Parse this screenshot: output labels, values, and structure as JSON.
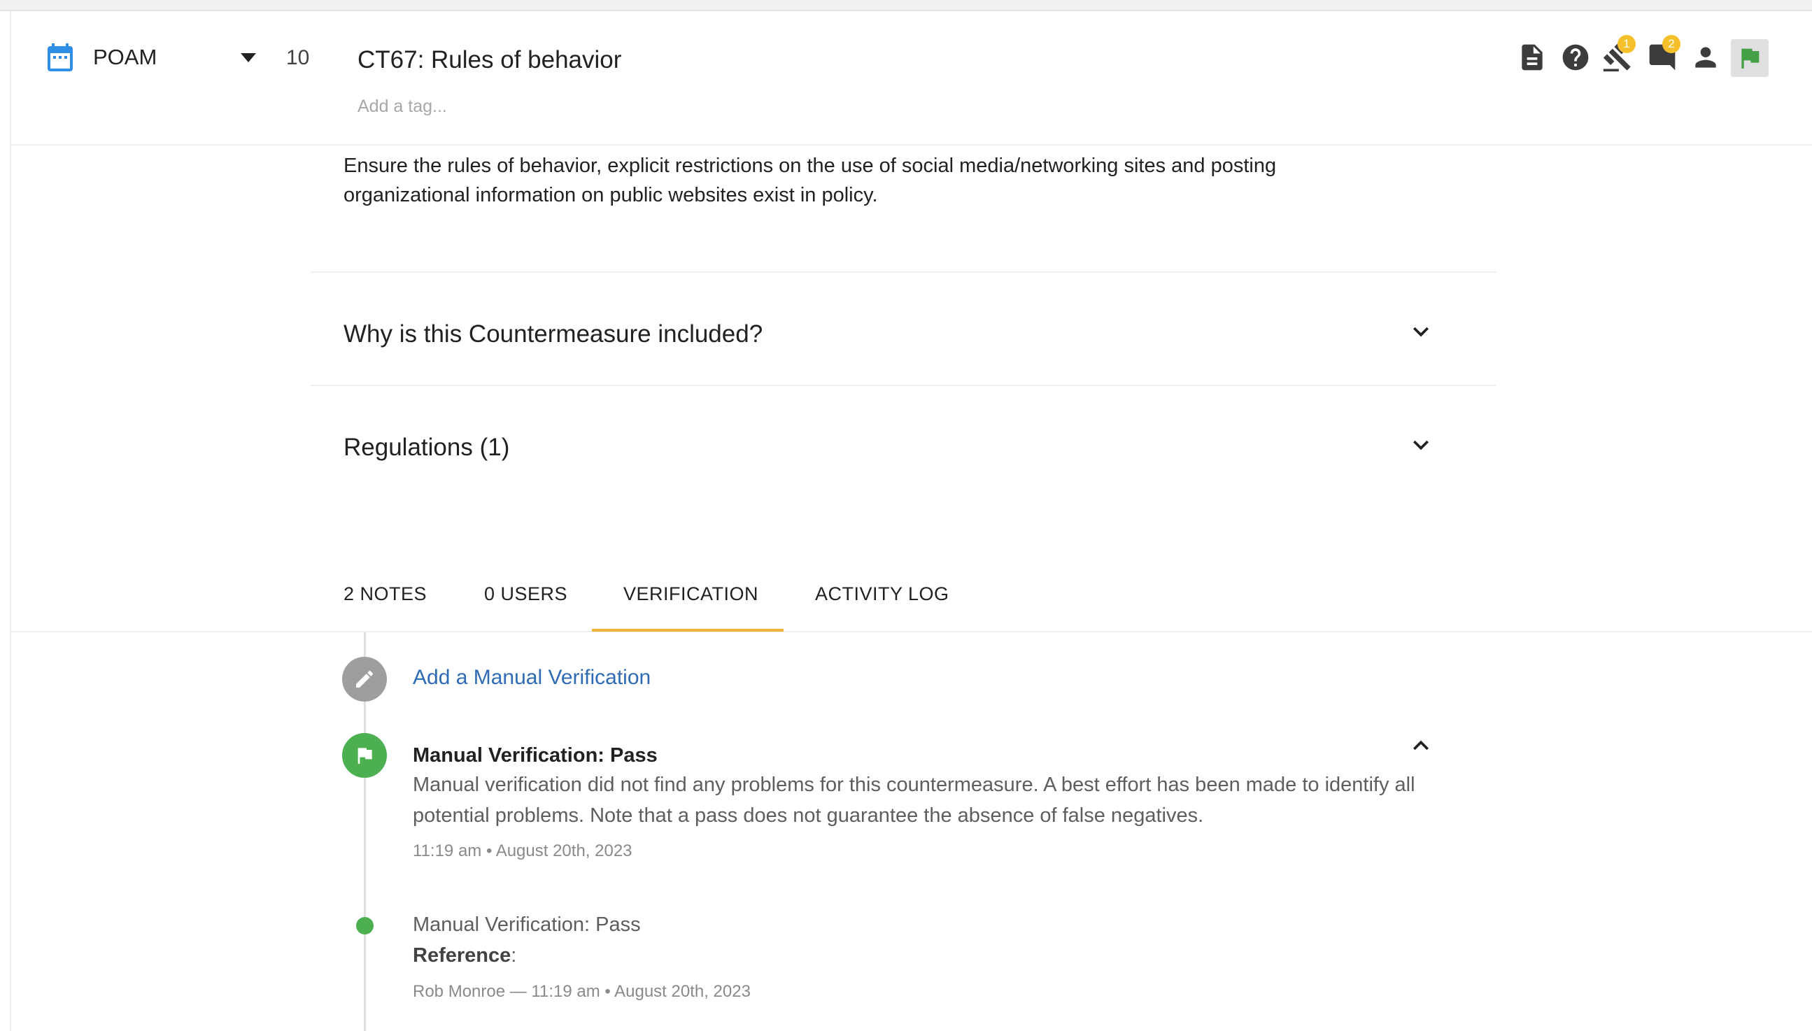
{
  "header": {
    "status": "POAM",
    "number": "10",
    "title": "CT67: Rules of behavior",
    "tag_placeholder": "Add a tag...",
    "legal_badge": "1",
    "comments_badge": "2"
  },
  "description": "Ensure the rules of behavior, explicit restrictions on the use of social media/networking sites and posting organizational information on public websites exist in policy.",
  "sections": {
    "why": "Why is this Countermeasure included?",
    "regulations": "Regulations (1)"
  },
  "tabs": {
    "notes": "2 NOTES",
    "users": "0 USERS",
    "verification": "VERIFICATION",
    "activity": "ACTIVITY LOG",
    "active": "VERIFICATION"
  },
  "verification": {
    "add_label": "Add a Manual Verification",
    "entry1": {
      "title": "Manual Verification: Pass",
      "body": "Manual verification did not find any problems for this countermeasure. A best effort has been made to identify all potential problems. Note that a pass does not guarantee the absence of false negatives.",
      "time": "11:19 am • August 20th, 2023"
    },
    "entry2": {
      "title": "Manual Verification: Pass",
      "reference_label": "Reference",
      "reference_suffix": ":",
      "author": "Rob Monroe",
      "separator": " — ",
      "time": "11:19 am • August 20th, 2023"
    }
  },
  "colors": {
    "accent": "#f0b43a",
    "link": "#2f6bb3",
    "calendar": "#2f8ee6",
    "pass": "#4caf50",
    "flag": "#43a047"
  }
}
